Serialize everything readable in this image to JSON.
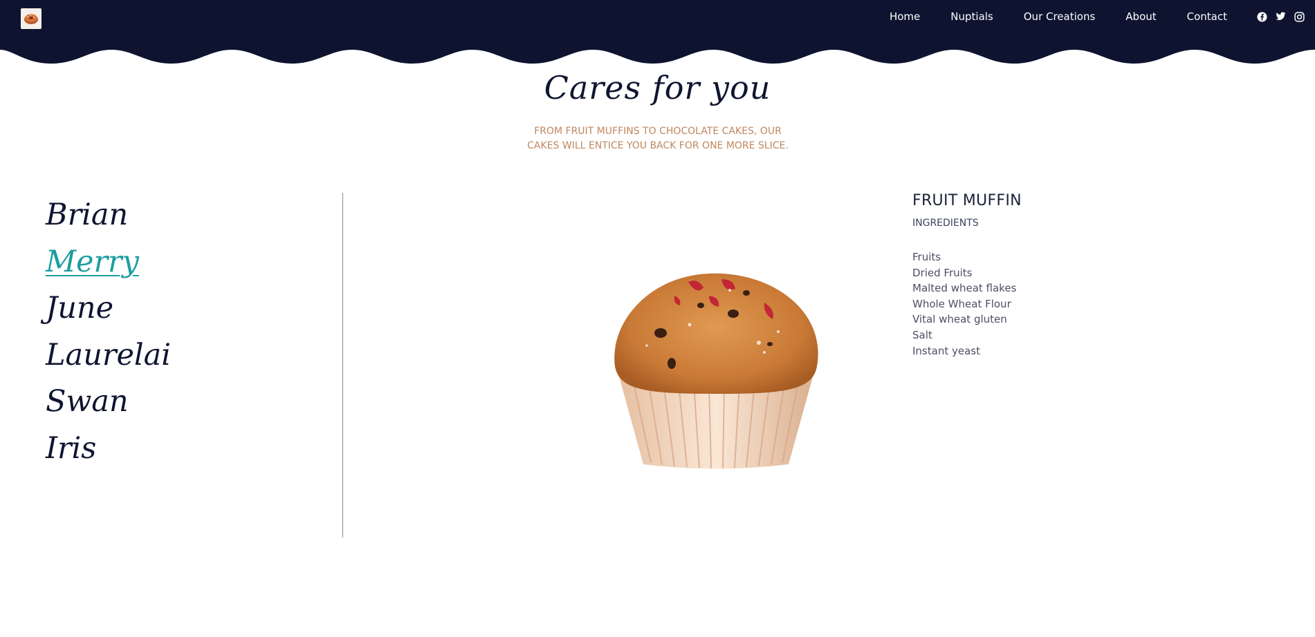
{
  "nav": {
    "logo_icon": "donut-logo-icon",
    "links": [
      "Home",
      "Nuptials",
      "Our Creations",
      "About",
      "Contact"
    ],
    "socials": [
      "facebook-icon",
      "twitter-icon",
      "instagram-icon"
    ],
    "colors": {
      "bar": "#0e1430",
      "text": "#ffffff"
    }
  },
  "hero": {
    "title": "Cares for you",
    "subtitle": "FROM FRUIT MUFFINS TO CHOCOLATE CAKES, OUR CAKES WILL ENTICE YOU BACK FOR ONE MORE SLICE."
  },
  "names": {
    "items": [
      "Brian",
      "Merry",
      "June",
      "Laurelai",
      "Swan",
      "Iris"
    ],
    "active": "Merry",
    "active_color": "#1d9da0"
  },
  "product": {
    "image": "fruit-muffin-photo",
    "name": "FRUIT MUFFIN",
    "ingredients_label": "INGREDIENTS",
    "ingredients": [
      "Fruits",
      "Dried Fruits",
      "Malted wheat flakes",
      "Whole Wheat Flour",
      "Vital wheat gluten",
      "Salt",
      "Instant yeast"
    ]
  },
  "colors": {
    "accent": "#1d9da0",
    "subtitle": "#c0875e",
    "navy": "#0f1530"
  }
}
